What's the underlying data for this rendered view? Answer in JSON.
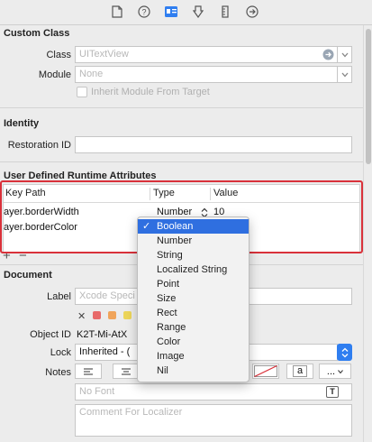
{
  "toolbar": {
    "icons": [
      "file-icon",
      "help-icon",
      "identity-icon",
      "attributes-icon",
      "ruler-icon",
      "connections-icon"
    ]
  },
  "custom_class": {
    "title": "Custom Class",
    "class_label": "Class",
    "class_placeholder": "UITextView",
    "module_label": "Module",
    "module_placeholder": "None",
    "inherit_label": "Inherit Module From Target"
  },
  "identity": {
    "title": "Identity",
    "restoration_label": "Restoration ID"
  },
  "runtime_attrs": {
    "title": "User Defined Runtime Attributes",
    "columns": [
      "Key Path",
      "Type",
      "Value"
    ],
    "rows": [
      {
        "key": "ayer.borderWidth",
        "type": "Number",
        "value": "10"
      },
      {
        "key": "ayer.borderColor",
        "type": "Boolean",
        "value": ""
      }
    ],
    "add_label": "+",
    "remove_label": "−"
  },
  "type_menu": {
    "items": [
      "Boolean",
      "Number",
      "String",
      "Localized String",
      "Point",
      "Size",
      "Rect",
      "Range",
      "Color",
      "Image",
      "Nil"
    ],
    "selected": "Boolean",
    "check": "✓"
  },
  "document": {
    "title": "Document",
    "label_label": "Label",
    "label_placeholder": "Xcode Speci",
    "object_id_label": "Object ID",
    "object_id_value": "K2T-Mi-AtX",
    "lock_label": "Lock",
    "lock_value": "Inherited - (",
    "notes_label": "Notes",
    "font_placeholder": "No Font",
    "comment_placeholder": "Comment For Localizer",
    "close_glyph": "✕",
    "font_glyph": "T",
    "more_glyph": "...",
    "strike_glyph": "a",
    "swatch_colors": [
      "#e86a6a",
      "#f0a45a",
      "#ecd55a"
    ]
  },
  "colors": {
    "accent": "#2f6fe0",
    "highlight_outline": "#d9313a"
  }
}
